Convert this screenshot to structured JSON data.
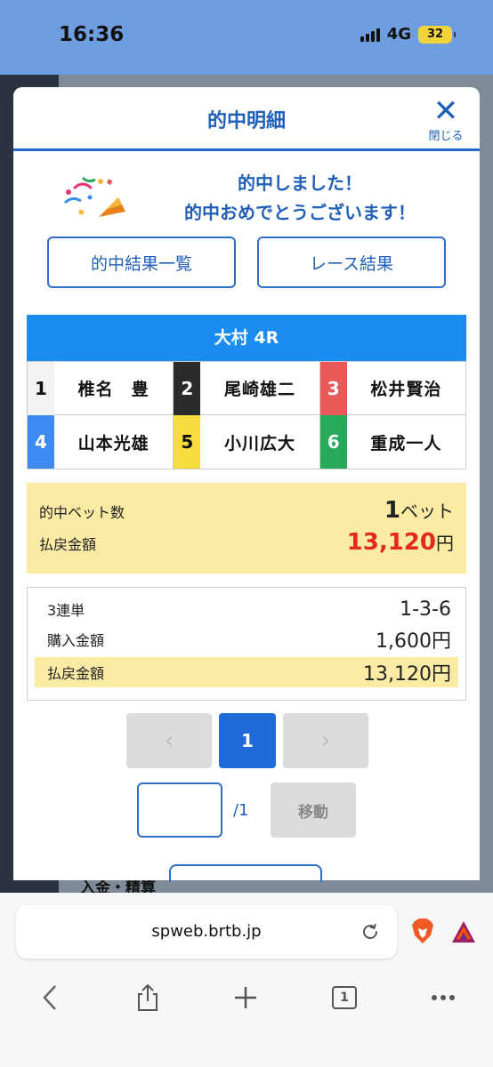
{
  "status_bar": {
    "time": "16:36",
    "network": "4G",
    "battery": "32"
  },
  "background": {
    "peek_text": "入金・精算"
  },
  "modal": {
    "title": "的中明細",
    "close_label": "閉じる",
    "congrats_line1": "的中しました！",
    "congrats_line2": "的中おめでとうございます！",
    "buttons": {
      "hit_list": "的中結果一覧",
      "race_result": "レース結果"
    },
    "race_title": "大村 4R",
    "racers": [
      {
        "lane": "1",
        "name": "椎名　豊",
        "color": "#f2f2f2",
        "text_color": "#111111"
      },
      {
        "lane": "2",
        "name": "尾崎雄二",
        "color": "#2a2a2a",
        "text_color": "#ffffff"
      },
      {
        "lane": "3",
        "name": "松井賢治",
        "color": "#e85a5a",
        "text_color": "#ffffff"
      },
      {
        "lane": "4",
        "name": "山本光雄",
        "color": "#3d8bf0",
        "text_color": "#ffffff"
      },
      {
        "lane": "5",
        "name": "小川広大",
        "color": "#f6dc3c",
        "text_color": "#111111"
      },
      {
        "lane": "6",
        "name": "重成一人",
        "color": "#27a95a",
        "text_color": "#ffffff"
      }
    ],
    "summary": {
      "hit_bets_label": "的中ベット数",
      "hit_bets_value": "1",
      "hit_bets_unit": "ベット",
      "payout_label": "払戻金額",
      "payout_value": "13,120",
      "payout_unit": "円"
    },
    "detail": {
      "bet_type": "3連単",
      "combination": "1-3-6",
      "purchase_label": "購入金額",
      "purchase_value": "1,600円",
      "payout_label": "払戻金額",
      "payout_value": "13,120円"
    },
    "pagination": {
      "prev": "‹",
      "current": "1",
      "next": "›",
      "total": "/1",
      "move_label": "移動"
    }
  },
  "browser": {
    "url": "spweb.brtb.jp",
    "tab_count": "1"
  },
  "colors": {
    "accent": "#1f5fb8",
    "race_header": "#1a8bf0",
    "highlight": "#fbeba5",
    "payout_red": "#e52a1a"
  }
}
